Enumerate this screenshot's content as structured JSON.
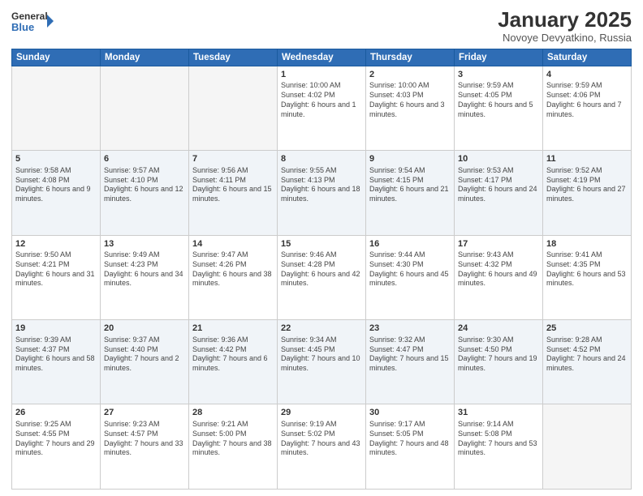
{
  "header": {
    "logo_line1": "General",
    "logo_line2": "Blue",
    "month": "January 2025",
    "location": "Novoye Devyatkino, Russia"
  },
  "weekdays": [
    "Sunday",
    "Monday",
    "Tuesday",
    "Wednesday",
    "Thursday",
    "Friday",
    "Saturday"
  ],
  "weeks": [
    [
      {
        "day": "",
        "info": ""
      },
      {
        "day": "",
        "info": ""
      },
      {
        "day": "",
        "info": ""
      },
      {
        "day": "1",
        "info": "Sunrise: 10:00 AM\nSunset: 4:02 PM\nDaylight: 6 hours\nand 1 minute."
      },
      {
        "day": "2",
        "info": "Sunrise: 10:00 AM\nSunset: 4:03 PM\nDaylight: 6 hours\nand 3 minutes."
      },
      {
        "day": "3",
        "info": "Sunrise: 9:59 AM\nSunset: 4:05 PM\nDaylight: 6 hours\nand 5 minutes."
      },
      {
        "day": "4",
        "info": "Sunrise: 9:59 AM\nSunset: 4:06 PM\nDaylight: 6 hours\nand 7 minutes."
      }
    ],
    [
      {
        "day": "5",
        "info": "Sunrise: 9:58 AM\nSunset: 4:08 PM\nDaylight: 6 hours\nand 9 minutes."
      },
      {
        "day": "6",
        "info": "Sunrise: 9:57 AM\nSunset: 4:10 PM\nDaylight: 6 hours\nand 12 minutes."
      },
      {
        "day": "7",
        "info": "Sunrise: 9:56 AM\nSunset: 4:11 PM\nDaylight: 6 hours\nand 15 minutes."
      },
      {
        "day": "8",
        "info": "Sunrise: 9:55 AM\nSunset: 4:13 PM\nDaylight: 6 hours\nand 18 minutes."
      },
      {
        "day": "9",
        "info": "Sunrise: 9:54 AM\nSunset: 4:15 PM\nDaylight: 6 hours\nand 21 minutes."
      },
      {
        "day": "10",
        "info": "Sunrise: 9:53 AM\nSunset: 4:17 PM\nDaylight: 6 hours\nand 24 minutes."
      },
      {
        "day": "11",
        "info": "Sunrise: 9:52 AM\nSunset: 4:19 PM\nDaylight: 6 hours\nand 27 minutes."
      }
    ],
    [
      {
        "day": "12",
        "info": "Sunrise: 9:50 AM\nSunset: 4:21 PM\nDaylight: 6 hours\nand 31 minutes."
      },
      {
        "day": "13",
        "info": "Sunrise: 9:49 AM\nSunset: 4:23 PM\nDaylight: 6 hours\nand 34 minutes."
      },
      {
        "day": "14",
        "info": "Sunrise: 9:47 AM\nSunset: 4:26 PM\nDaylight: 6 hours\nand 38 minutes."
      },
      {
        "day": "15",
        "info": "Sunrise: 9:46 AM\nSunset: 4:28 PM\nDaylight: 6 hours\nand 42 minutes."
      },
      {
        "day": "16",
        "info": "Sunrise: 9:44 AM\nSunset: 4:30 PM\nDaylight: 6 hours\nand 45 minutes."
      },
      {
        "day": "17",
        "info": "Sunrise: 9:43 AM\nSunset: 4:32 PM\nDaylight: 6 hours\nand 49 minutes."
      },
      {
        "day": "18",
        "info": "Sunrise: 9:41 AM\nSunset: 4:35 PM\nDaylight: 6 hours\nand 53 minutes."
      }
    ],
    [
      {
        "day": "19",
        "info": "Sunrise: 9:39 AM\nSunset: 4:37 PM\nDaylight: 6 hours\nand 58 minutes."
      },
      {
        "day": "20",
        "info": "Sunrise: 9:37 AM\nSunset: 4:40 PM\nDaylight: 7 hours\nand 2 minutes."
      },
      {
        "day": "21",
        "info": "Sunrise: 9:36 AM\nSunset: 4:42 PM\nDaylight: 7 hours\nand 6 minutes."
      },
      {
        "day": "22",
        "info": "Sunrise: 9:34 AM\nSunset: 4:45 PM\nDaylight: 7 hours\nand 10 minutes."
      },
      {
        "day": "23",
        "info": "Sunrise: 9:32 AM\nSunset: 4:47 PM\nDaylight: 7 hours\nand 15 minutes."
      },
      {
        "day": "24",
        "info": "Sunrise: 9:30 AM\nSunset: 4:50 PM\nDaylight: 7 hours\nand 19 minutes."
      },
      {
        "day": "25",
        "info": "Sunrise: 9:28 AM\nSunset: 4:52 PM\nDaylight: 7 hours\nand 24 minutes."
      }
    ],
    [
      {
        "day": "26",
        "info": "Sunrise: 9:25 AM\nSunset: 4:55 PM\nDaylight: 7 hours\nand 29 minutes."
      },
      {
        "day": "27",
        "info": "Sunrise: 9:23 AM\nSunset: 4:57 PM\nDaylight: 7 hours\nand 33 minutes."
      },
      {
        "day": "28",
        "info": "Sunrise: 9:21 AM\nSunset: 5:00 PM\nDaylight: 7 hours\nand 38 minutes."
      },
      {
        "day": "29",
        "info": "Sunrise: 9:19 AM\nSunset: 5:02 PM\nDaylight: 7 hours\nand 43 minutes."
      },
      {
        "day": "30",
        "info": "Sunrise: 9:17 AM\nSunset: 5:05 PM\nDaylight: 7 hours\nand 48 minutes."
      },
      {
        "day": "31",
        "info": "Sunrise: 9:14 AM\nSunset: 5:08 PM\nDaylight: 7 hours\nand 53 minutes."
      },
      {
        "day": "",
        "info": ""
      }
    ]
  ]
}
